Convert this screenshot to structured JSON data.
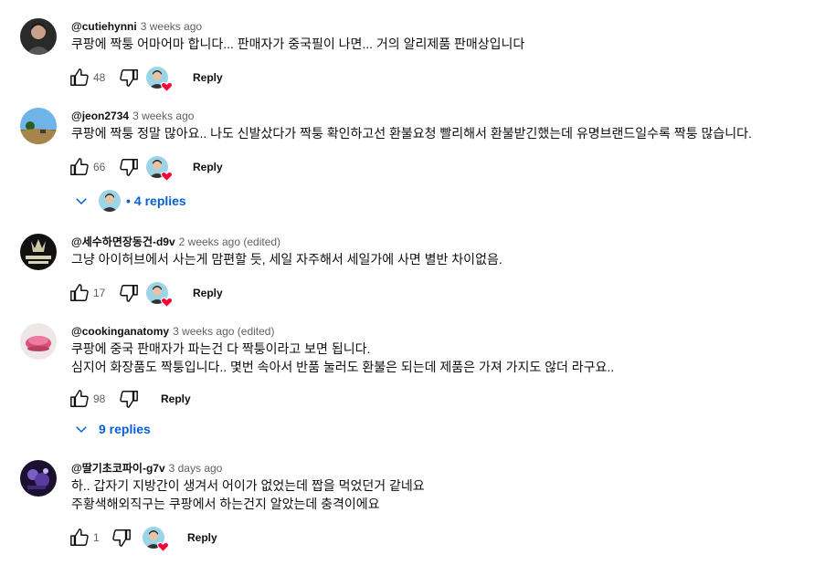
{
  "comments": [
    {
      "author": "@cutiehynni",
      "time": "3 weeks ago",
      "lines": [
        "쿠팡에 짝퉁 어마어마 합니다... 판매자가 중국필이 나면... 거의 알리제품 판매상입니다"
      ],
      "likes": "48",
      "reply_label": "Reply",
      "avatar_icon": "user-photo-icon",
      "creator_hearted": true
    },
    {
      "author": "@jeon2734",
      "time": "3 weeks ago",
      "lines": [
        "쿠팡에 짝퉁 정말 많아요.. 나도 신발샀다가 짝퉁 확인하고선 환불요청 빨리해서 환불받긴했는데 유명브랜드일수록 짝퉁 많습니다."
      ],
      "likes": "66",
      "reply_label": "Reply",
      "creator_hearted": true,
      "replies": "4 replies"
    },
    {
      "author": "@세수하면장동건-d9v",
      "time": "2 weeks ago (edited)",
      "lines": [
        "그냥 아이허브에서 사는게 맘편할 듯, 세일 자주해서 세일가에 사면 별반 차이없음."
      ],
      "likes": "17",
      "reply_label": "Reply",
      "creator_hearted": true
    },
    {
      "author": "@cookinganatomy",
      "time": "3 weeks ago (edited)",
      "lines": [
        "쿠팡에 중국 판매자가 파는건 다 짝퉁이라고 보면 됩니다.",
        "심지어 화장품도 짝퉁입니다.. 몇번 속아서 반품 눌러도 환불은 되는데 제품은 가져 가지도 않더 라구요.."
      ],
      "likes": "98",
      "reply_label": "Reply",
      "creator_hearted": false,
      "replies": "9 replies"
    },
    {
      "author": "@딸기초코파이-g7v",
      "time": "3 days ago",
      "lines": [
        "하.. 갑자기 지방간이 생겨서 어이가 없었는데 짭을 먹었던거 같네요",
        "주황색해외직구는 쿠팡에서 하는건지 알았는데 충격이에요"
      ],
      "likes": "1",
      "reply_label": "Reply",
      "creator_hearted": true
    }
  ],
  "colors": {
    "link_blue": "#065fd4",
    "heart_red": "#ff0033",
    "meta_gray": "#606060"
  }
}
